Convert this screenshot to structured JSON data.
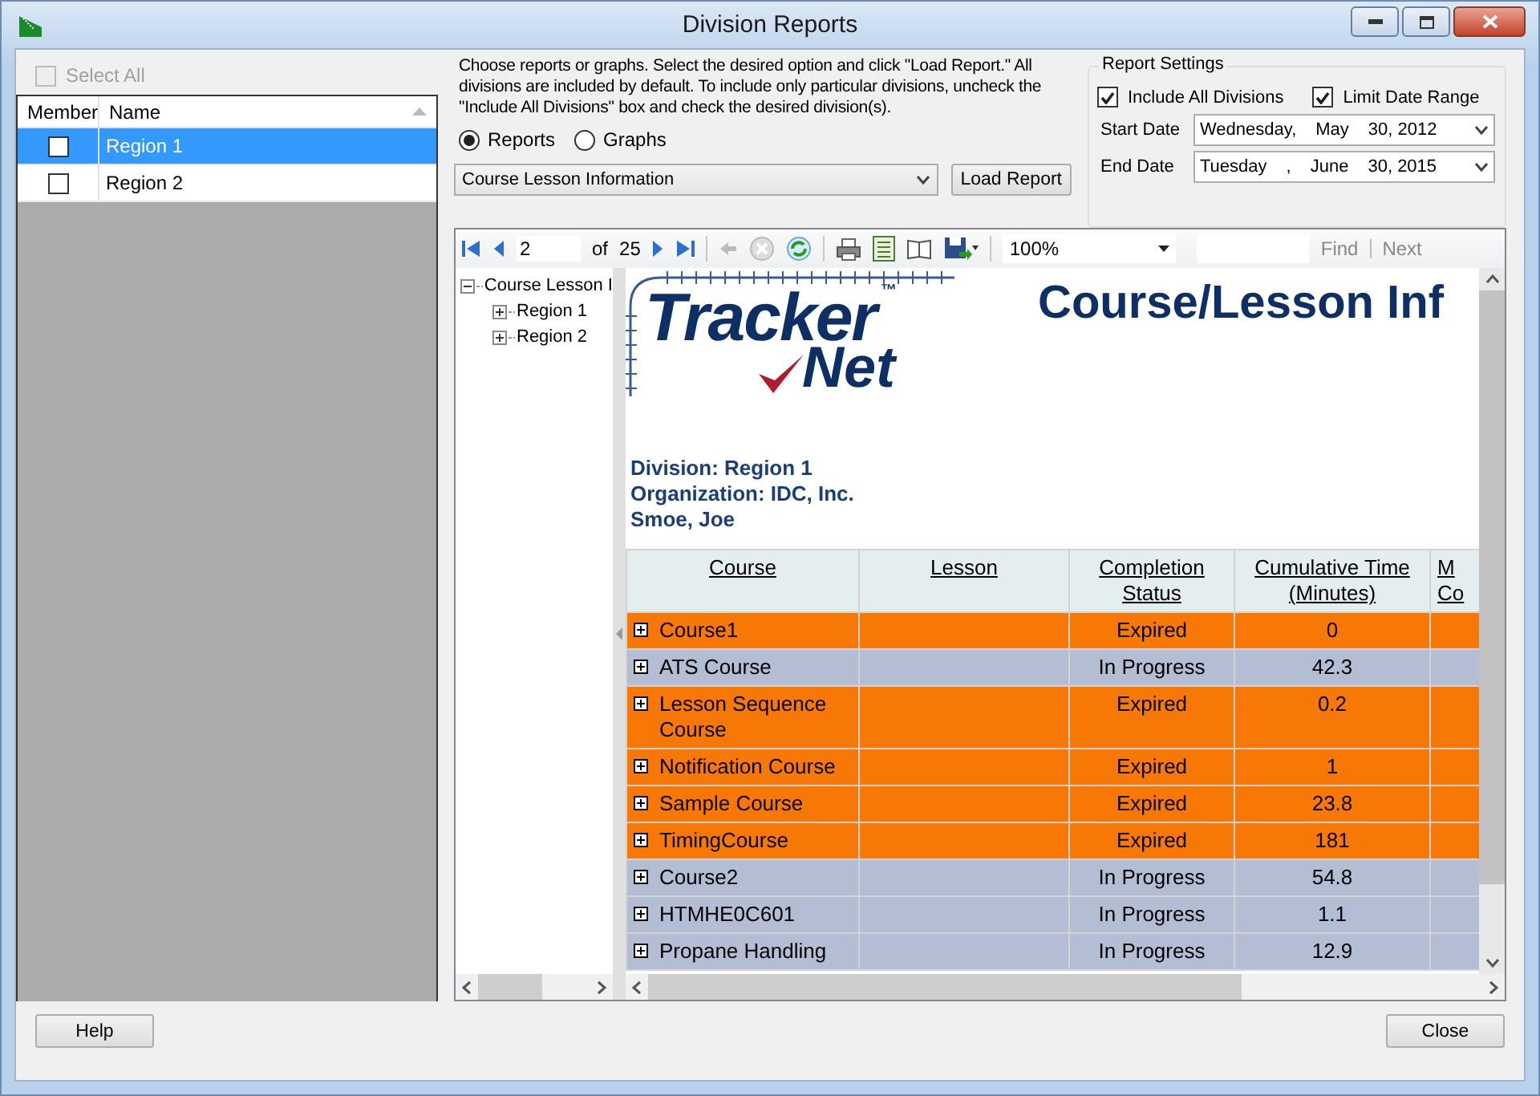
{
  "window": {
    "title": "Division Reports"
  },
  "divisions": {
    "select_all": {
      "label": "Select All",
      "checked": false,
      "disabled": true
    },
    "columns": [
      "Member",
      "Name"
    ],
    "rows": [
      {
        "name": "Region 1",
        "checked": false,
        "selected": true
      },
      {
        "name": "Region 2",
        "checked": false,
        "selected": false
      }
    ]
  },
  "instructions": "Choose reports or graphs. Select the desired option and click \"Load Report.\" All divisions are included by default. To include only particular divisions, uncheck the \"Include All Divisions\" box and check the desired division(s).",
  "report_type": [
    {
      "label": "Reports",
      "selected": true
    },
    {
      "label": "Graphs",
      "selected": false
    }
  ],
  "report_select": {
    "value": "Course Lesson Information"
  },
  "load_button": "Load Report",
  "report_settings": {
    "title": "Report Settings",
    "options": [
      {
        "label": "Include All Divisions",
        "checked": true
      },
      {
        "label": "Limit Date Range",
        "checked": true
      }
    ],
    "dates": [
      {
        "label": "Start Date",
        "parts": [
          "Wednesday,",
          "May",
          "30, 2012"
        ]
      },
      {
        "label": "End Date",
        "parts": [
          "Tuesday",
          ",",
          "June",
          "30, 2015"
        ]
      }
    ]
  },
  "viewer": {
    "page": "2",
    "of_label": "of",
    "total_pages": "25",
    "zoom": "100%",
    "find": "Find",
    "next": "Next",
    "doc_map": {
      "label": "Course Lesson I",
      "expanded": true,
      "children": [
        {
          "label": "Region 1",
          "expanded": false
        },
        {
          "label": "Region 2",
          "expanded": false
        }
      ]
    },
    "report": {
      "logo": {
        "line_1": "Tracker",
        "line_2": "Net",
        "mark": "™"
      },
      "title": "Course/Lesson Inf",
      "info": [
        "Division: Region 1",
        "Organization: IDC, Inc.",
        "Smoe, Joe"
      ],
      "columns": [
        "Course",
        "Lesson",
        "Completion\nStatus",
        "Cumulative Time\n(Minutes)",
        "M\nCo"
      ],
      "rows": [
        {
          "cells": [
            "Course1",
            "",
            "Expired",
            "0"
          ],
          "color": "#f77804"
        },
        {
          "cells": [
            "ATS Course",
            "",
            "In Progress",
            "42.3"
          ],
          "color": "#b3bdd3"
        },
        {
          "cells": [
            "Lesson Sequence Course",
            "",
            "Expired",
            "0.2"
          ],
          "color": "#f77804"
        },
        {
          "cells": [
            "Notification Course",
            "",
            "Expired",
            "1"
          ],
          "color": "#f77804"
        },
        {
          "cells": [
            "Sample Course",
            "",
            "Expired",
            "23.8"
          ],
          "color": "#f77804"
        },
        {
          "cells": [
            "TimingCourse",
            "",
            "Expired",
            "181"
          ],
          "color": "#f77804"
        },
        {
          "cells": [
            "Course2",
            "",
            "In Progress",
            "54.8"
          ],
          "color": "#b3bdd3"
        },
        {
          "cells": [
            "HTMHE0C601",
            "",
            "In Progress",
            "1.1"
          ],
          "color": "#b3bdd3"
        },
        {
          "cells": [
            "Propane Handling",
            "",
            "In Progress",
            "12.9"
          ],
          "color": "#b3bdd3"
        }
      ]
    }
  },
  "buttons": {
    "help": "Help",
    "close": "Close"
  }
}
